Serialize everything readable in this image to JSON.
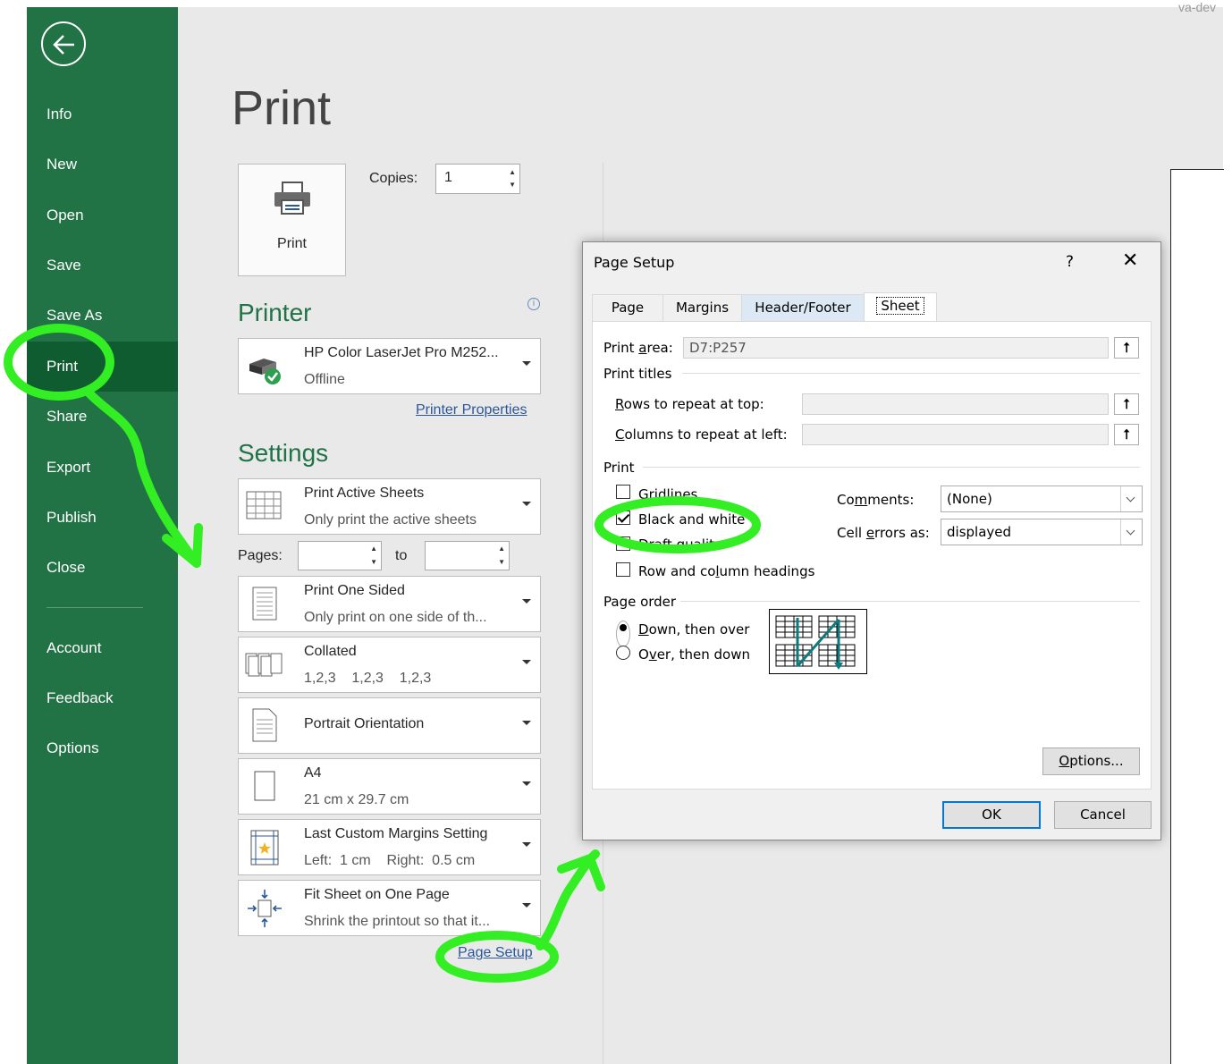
{
  "nav": {
    "items": [
      "Info",
      "New",
      "Open",
      "Save",
      "Save As",
      "Print",
      "Share",
      "Export",
      "Publish",
      "Close",
      "Account",
      "Feedback",
      "Options"
    ],
    "active": "Print"
  },
  "corner_text": "va-dev",
  "page": {
    "title": "Print"
  },
  "print_button": {
    "label": "Print"
  },
  "copies": {
    "label": "Copies:",
    "value": "1"
  },
  "printer": {
    "heading": "Printer",
    "name": "HP Color LaserJet Pro M252...",
    "status": "Offline",
    "properties_link": "Printer Properties"
  },
  "settings": {
    "heading": "Settings",
    "active_sheets": {
      "title": "Print Active Sheets",
      "sub": "Only print the active sheets"
    },
    "pages_label": "Pages:",
    "to_label": "to",
    "sided": {
      "title": "Print One Sided",
      "sub": "Only print on one side of th..."
    },
    "collated": {
      "title": "Collated",
      "sub": "1,2,3    1,2,3    1,2,3"
    },
    "orientation": {
      "title": "Portrait Orientation"
    },
    "paper": {
      "title": "A4",
      "sub": "21 cm x 29.7 cm"
    },
    "margins": {
      "title": "Last Custom Margins Setting",
      "sub": "Left:  1 cm    Right:  0.5 cm"
    },
    "scaling": {
      "title": "Fit Sheet on One Page",
      "sub": "Shrink the printout so that it..."
    },
    "page_setup_link": "Page Setup"
  },
  "dialog": {
    "title": "Page Setup",
    "help": "?",
    "close": "✕",
    "tabs": [
      "Page",
      "Margins",
      "Header/Footer",
      "Sheet"
    ],
    "active_tab": "Sheet",
    "print_area_label": [
      "Print ",
      "a",
      "rea:"
    ],
    "print_area_value": "D7:P257",
    "print_titles": "Print titles",
    "rows_repeat": [
      "R",
      "ows to repeat at top:"
    ],
    "cols_repeat": [
      "C",
      "olumns to repeat at left:"
    ],
    "print_group": "Print",
    "gridlines": {
      "label": "Gridlines",
      "checked": false
    },
    "black_white": {
      "label": "Black and white",
      "checked": true
    },
    "draft": {
      "label": "Draft quality",
      "checked": false
    },
    "headings": {
      "label_pre": "Row and co",
      "label_u": "l",
      "label_post": "umn headings",
      "checked": false
    },
    "comments_label": [
      "Co",
      "m",
      "ments:"
    ],
    "comments_value": "(None)",
    "cell_errors_label": [
      "Cell ",
      "e",
      "rrors as:"
    ],
    "cell_errors_value": "displayed",
    "page_order": "Page order",
    "down_over": {
      "u": "D",
      "rest": "own, then over",
      "selected": true
    },
    "over_down": {
      "pre": "O",
      "u": "v",
      "rest": "er, then down",
      "selected": false
    },
    "options_btn": {
      "u": "O",
      "rest": "ptions..."
    },
    "ok": "OK",
    "cancel": "Cancel"
  }
}
